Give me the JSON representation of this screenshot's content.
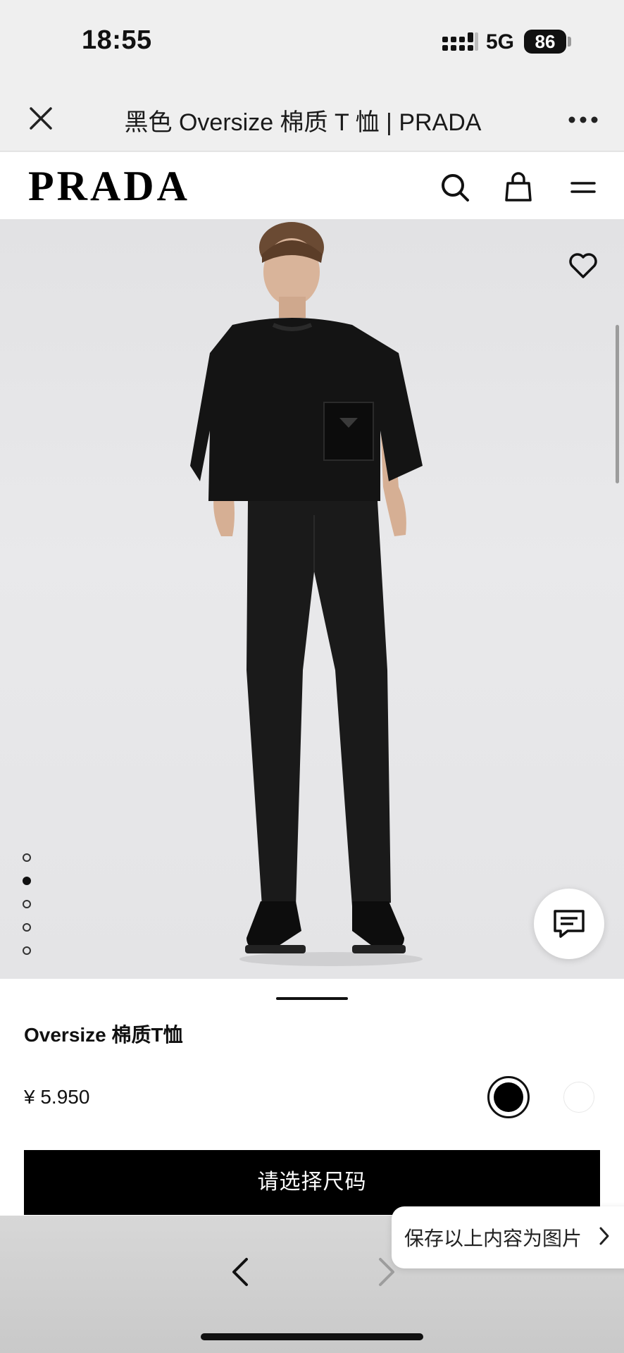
{
  "status_bar": {
    "time": "18:55",
    "network": "5G",
    "battery": "86"
  },
  "browser": {
    "title": "黑色 Oversize 棉质 T 恤 | PRADA",
    "close_icon": "close-icon",
    "more_icon": "more-icon"
  },
  "header": {
    "logo": "PRADA",
    "icons": [
      "search-icon",
      "shopping-bag-icon",
      "menu-icon"
    ]
  },
  "gallery": {
    "image_count": 5,
    "active_index": 1,
    "favorite_icon": "heart-icon",
    "chat_icon": "chat-icon"
  },
  "product": {
    "name": "Oversize 棉质T恤",
    "price": "¥ 5.950",
    "colors": [
      {
        "name": "black",
        "hex": "#000000",
        "selected": true
      },
      {
        "name": "white",
        "hex": "#ffffff",
        "selected": false
      }
    ],
    "select_size_label": "请选择尺码"
  },
  "popup": {
    "save_label": "保存以上内容为图片"
  },
  "navigation": {
    "back_icon": "chevron-left-icon",
    "forward_icon": "chevron-right-icon"
  }
}
